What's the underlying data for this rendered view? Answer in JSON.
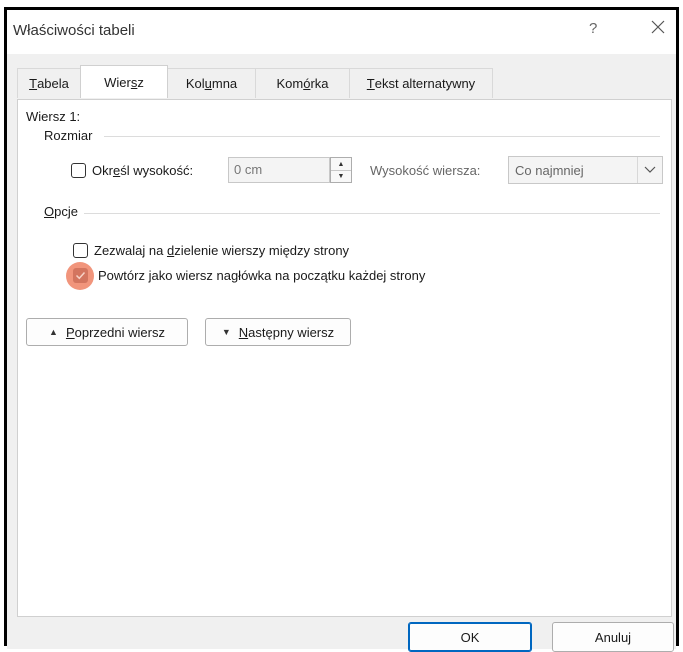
{
  "window": {
    "title": "Właściwości tabeli",
    "help_label": "?",
    "close_icon": "close-icon"
  },
  "tabs": [
    {
      "pre": "",
      "acc": "T",
      "post": "abela",
      "active": false
    },
    {
      "pre": "Wier",
      "acc": "s",
      "post": "z",
      "active": true
    },
    {
      "pre": "Kol",
      "acc": "u",
      "post": "mna",
      "active": false
    },
    {
      "pre": "Kom",
      "acc": "ó",
      "post": "rka",
      "active": false
    },
    {
      "pre": "",
      "acc": "T",
      "post": "ekst alternatywny",
      "active": false
    }
  ],
  "row": {
    "heading": "Wiersz 1:",
    "size_section": "Rozmiar",
    "specify_height": {
      "pre": "Okr",
      "acc": "e",
      "post": "śl wysokość:",
      "checked": false
    },
    "height_value": "0 cm",
    "row_height_label": "Wysokość wiersza:",
    "row_height_option": "Co najmniej",
    "options_section": {
      "pre": "",
      "acc": "O",
      "post": "pcje"
    },
    "allow_break": {
      "pre": "Zezwalaj na ",
      "acc": "d",
      "post": "zielenie wierszy między strony",
      "checked": false
    },
    "repeat_header": {
      "pre": "Powtórz ",
      "acc": "j",
      "post": "ako wiersz nagłówka na początku każdej strony",
      "checked": true
    }
  },
  "nav": {
    "prev": {
      "pre": "",
      "acc": "P",
      "post": "oprzedni wiersz"
    },
    "next": {
      "pre": "",
      "acc": "N",
      "post": "astępny wiersz"
    }
  },
  "footer": {
    "ok": "OK",
    "cancel": "Anuluj"
  },
  "colors": {
    "focus_highlight": "#f08a6e",
    "ok_border": "#0067c0"
  }
}
